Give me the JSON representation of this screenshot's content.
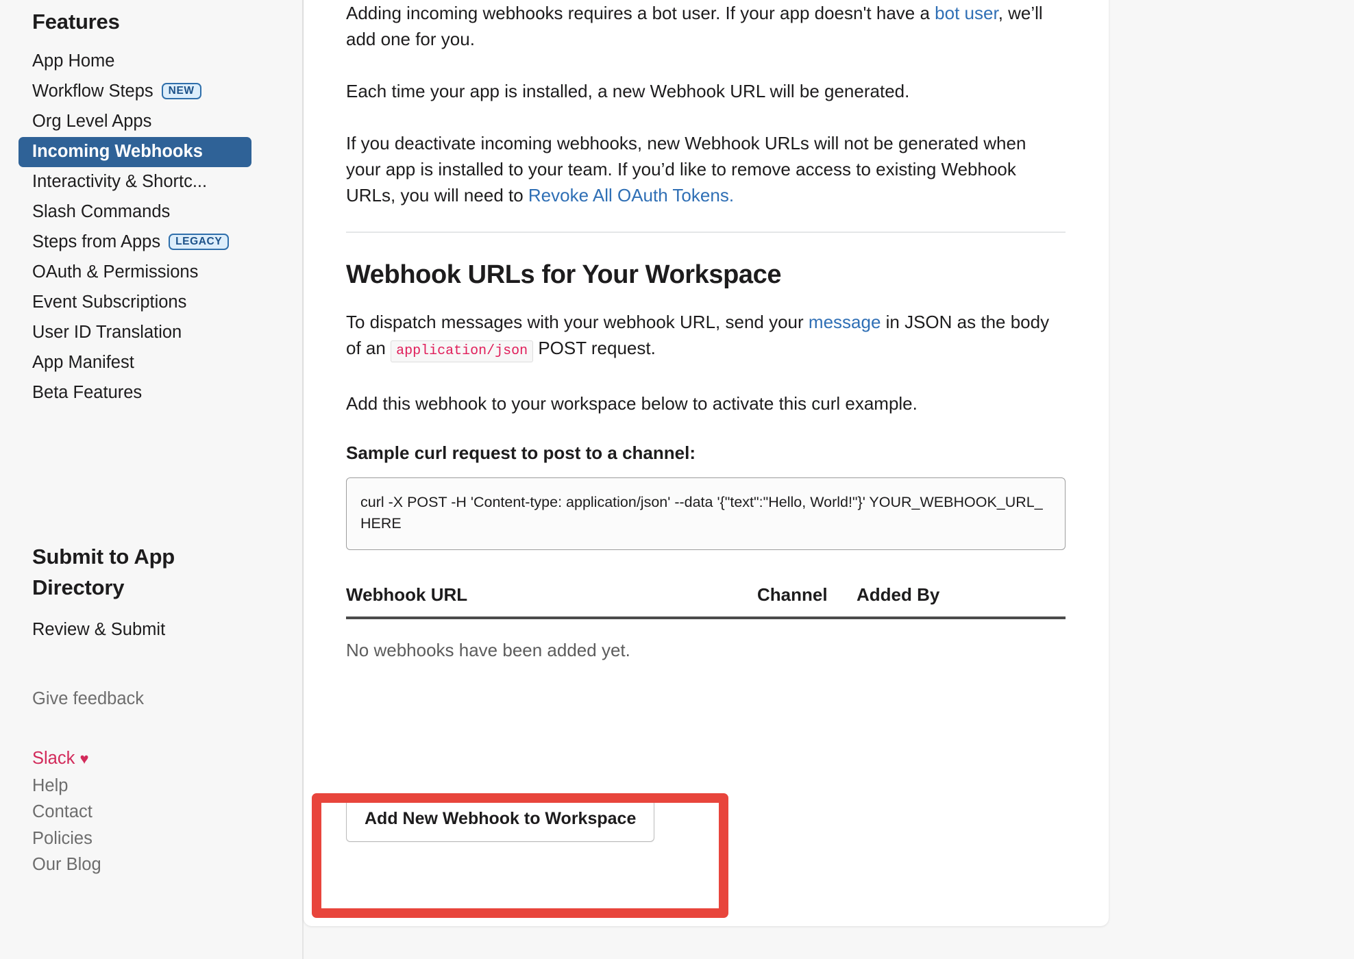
{
  "sidebar": {
    "features_heading": "Features",
    "features_items": [
      {
        "label": "App Home",
        "badge": null,
        "active": false
      },
      {
        "label": "Workflow Steps",
        "badge": "NEW",
        "active": false
      },
      {
        "label": "Org Level Apps",
        "badge": null,
        "active": false
      },
      {
        "label": "Incoming Webhooks",
        "badge": null,
        "active": true
      },
      {
        "label": "Interactivity & Shortc...",
        "badge": null,
        "active": false
      },
      {
        "label": "Slash Commands",
        "badge": null,
        "active": false
      },
      {
        "label": "Steps from Apps",
        "badge": "LEGACY",
        "active": false
      },
      {
        "label": "OAuth & Permissions",
        "badge": null,
        "active": false
      },
      {
        "label": "Event Subscriptions",
        "badge": null,
        "active": false
      },
      {
        "label": "User ID Translation",
        "badge": null,
        "active": false
      },
      {
        "label": "App Manifest",
        "badge": null,
        "active": false
      },
      {
        "label": "Beta Features",
        "badge": null,
        "active": false
      }
    ],
    "submit_heading": "Submit to App Directory",
    "submit_items": [
      {
        "label": "Review & Submit"
      }
    ],
    "feedback_label": "Give feedback",
    "footer_links": [
      {
        "label": "Slack",
        "icon": "heart-icon",
        "brand": true
      },
      {
        "label": "Help",
        "brand": false
      },
      {
        "label": "Contact",
        "brand": false
      },
      {
        "label": "Policies",
        "brand": false
      },
      {
        "label": "Our Blog",
        "brand": false
      }
    ],
    "heart_glyph": "♥"
  },
  "main": {
    "intro": {
      "p1_a": "Adding incoming webhooks requires a bot user. If your app doesn't have a ",
      "p1_link": "bot user",
      "p1_b": ", we’ll add one for you.",
      "p2": "Each time your app is installed, a new Webhook URL will be generated.",
      "p3_a": "If you deactivate incoming webhooks, new Webhook URLs will not be generated when your app is installed to your team. If you’d like to remove access to existing Webhook URLs, you will need to ",
      "p3_link": "Revoke All OAuth Tokens.",
      "p3_b": ""
    },
    "section_title": "Webhook URLs for Your Workspace",
    "dispatch": {
      "a": "To dispatch messages with your webhook URL, send your ",
      "link": "message",
      "b": " in JSON as the body of an ",
      "code": "application/json",
      "c": " POST request."
    },
    "activate_text": "Add this webhook to your workspace below to activate this curl example.",
    "curl_label": "Sample curl request to post to a channel:",
    "curl_code": "curl -X POST -H 'Content-type: application/json' --data '{\"text\":\"Hello, World!\"}' YOUR_WEBHOOK_URL_HERE",
    "table": {
      "headers": [
        "Webhook URL",
        "Channel",
        "Added By"
      ],
      "empty_message": "No webhooks have been added yet."
    },
    "add_button_label": "Add New Webhook to Workspace"
  },
  "annotation": {
    "highlight_color": "#e8453c",
    "target": "add-webhook-button"
  },
  "colors": {
    "active_nav": "#2f6297",
    "link": "#2f6fb5",
    "brand": "#d22a5a",
    "code_text": "#e01e5a",
    "badge_text": "#1d5289",
    "badge_bg": "#ddeefb"
  }
}
